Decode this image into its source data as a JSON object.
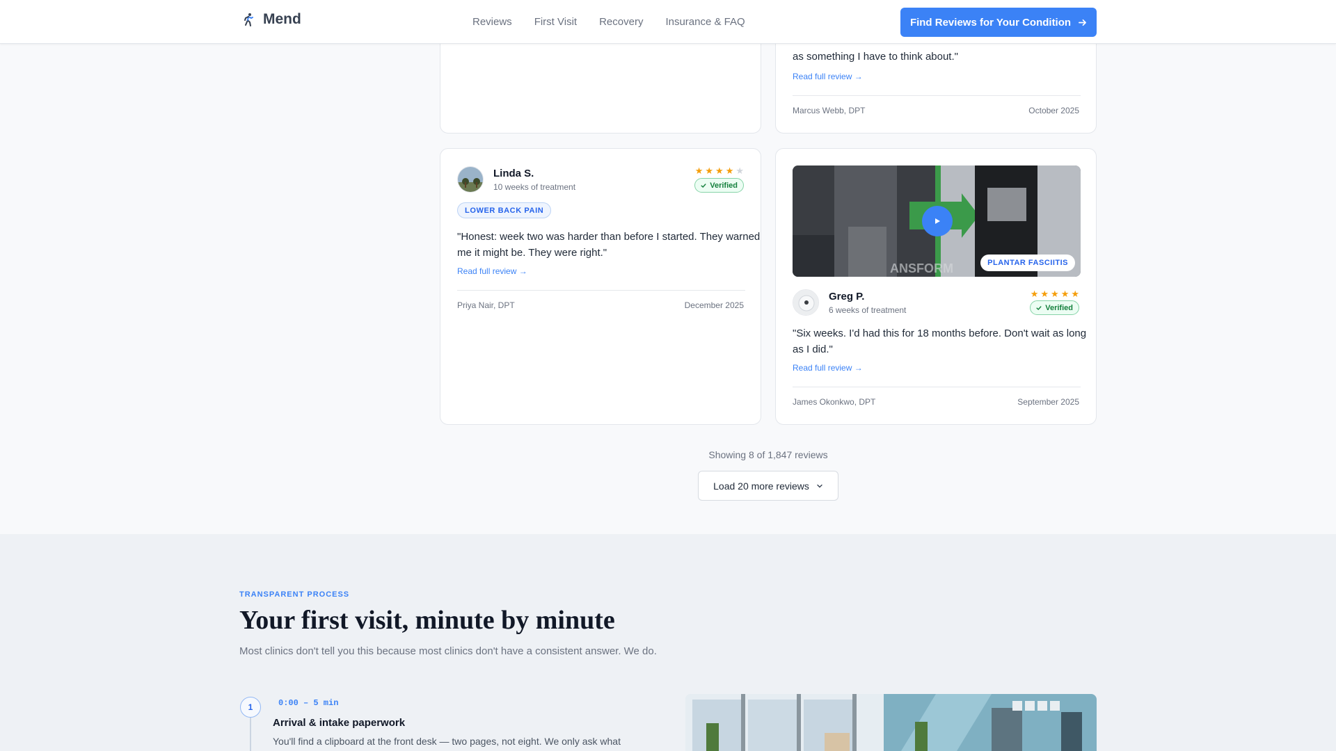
{
  "nav": {
    "brand": "Mend",
    "links": [
      "Reviews",
      "First Visit",
      "Recovery",
      "Insurance & FAQ"
    ],
    "cta": "Find Reviews for Your Condition"
  },
  "top_right_card": {
    "quote_tail": "as something I have to think about.\"",
    "read_more": "Read full review →",
    "therapist": "Marcus Webb, DPT",
    "date": "October 2025"
  },
  "reviews": [
    {
      "name": "Linda S.",
      "duration": "10 weeks of treatment",
      "rating": 4,
      "verified": "Verified",
      "condition": "LOWER BACK PAIN",
      "quote_line1": "\"Honest: week two was harder than before I started. They warned",
      "quote_line2": "me it might be. They were right.\"",
      "read_more": "Read full review →",
      "therapist": "Priya Nair, DPT",
      "date": "December 2025"
    },
    {
      "name": "Greg P.",
      "duration": "6 weeks of treatment",
      "rating": 5,
      "verified": "Verified",
      "condition": "PLANTAR FASCIITIS",
      "quote_line1": "\"Six weeks. I'd had this for 18 months before. Don't wait as long",
      "quote_line2": "as I did.\"",
      "read_more": "Read full review →",
      "therapist": "James Okonkwo, DPT",
      "date": "September 2025"
    }
  ],
  "pagination": {
    "showing": "Showing 8 of 1,847 reviews",
    "load_more": "Load 20 more reviews"
  },
  "first_visit": {
    "eyebrow": "TRANSPARENT PROCESS",
    "title": "Your first visit, minute by minute",
    "lead": "Most clinics don't tell you this because most clinics don't have a consistent answer. We do.",
    "steps": [
      {
        "number": "1",
        "time": "0:00 – 5 min",
        "title": "Arrival & intake paperwork",
        "body": "You'll find a clipboard at the front desk — two pages, not eight. We only ask what"
      }
    ]
  },
  "colors": {
    "accent": "#3b82f6",
    "star": "#f59e0b",
    "verified": "#15803d"
  },
  "icons": [
    "runner-logo-icon",
    "arrow-right-icon",
    "checkmark-icon",
    "star-icon",
    "play-icon",
    "chevron-down-icon"
  ]
}
